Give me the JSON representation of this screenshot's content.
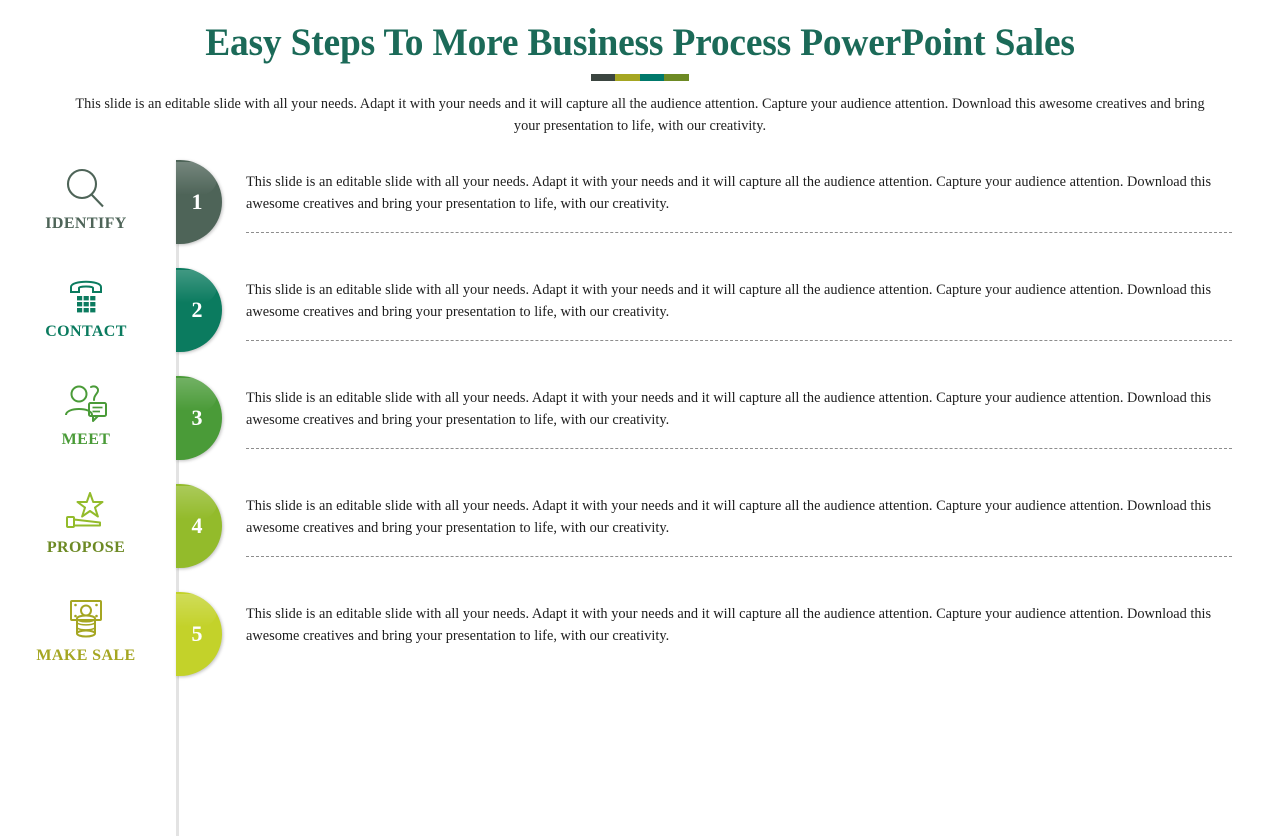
{
  "header": {
    "title": "Easy Steps To More Business Process PowerPoint Sales",
    "subtitle": "This slide is an editable slide with all your needs. Adapt it with your needs and it will capture all the audience attention. Capture your audience attention. Download this awesome creatives and bring your presentation to life, with our creativity.",
    "divider_colors": [
      "#3b4540",
      "#a5a622",
      "#00796b",
      "#6d8a24"
    ],
    "title_color": "#1b6a58"
  },
  "body_text": "This slide is an editable slide with all your needs. Adapt it with your needs and it will capture all the audience attention. Capture your audience attention. Download this awesome creatives and bring your presentation to life, with our creativity.",
  "steps": [
    {
      "number": "1",
      "label": "IDENTIFY",
      "icon": "magnifier-icon",
      "color": "#4e6458",
      "text": "This slide is an editable slide with all your needs. Adapt it with your needs and it will capture all the audience attention. Capture your audience attention. Download this awesome creatives and bring your presentation to life, with our creativity."
    },
    {
      "number": "2",
      "label": "CONTACT",
      "icon": "telephone-icon",
      "color": "#0b7b5f",
      "text": "This slide is an editable slide with all your needs. Adapt it with your needs and it will capture all the audience attention. Capture your audience attention. Download this awesome creatives and bring your presentation to life, with our creativity."
    },
    {
      "number": "3",
      "label": "MEET",
      "icon": "person-chat-icon",
      "color": "#4a9b38",
      "text": "This slide is an editable slide with all your needs. Adapt it with your needs and it will capture all the audience attention. Capture your audience attention. Download this awesome creatives and bring your presentation to life, with our creativity."
    },
    {
      "number": "4",
      "label": "PROPOSE",
      "icon": "star-hand-icon",
      "color": "#93bb2b",
      "text": "This slide is an editable slide with all your needs. Adapt it with your needs and it will capture all the audience attention. Capture your audience attention. Download this awesome creatives and bring your presentation to life, with our creativity."
    },
    {
      "number": "5",
      "label": "MAKE SALE",
      "icon": "money-icon",
      "color": "#c3d22a",
      "text": "This slide is an editable slide with all your needs. Adapt it with your needs and it will capture all the audience attention. Capture your audience attention. Download this awesome creatives and bring your presentation to life, with our creativity."
    }
  ]
}
